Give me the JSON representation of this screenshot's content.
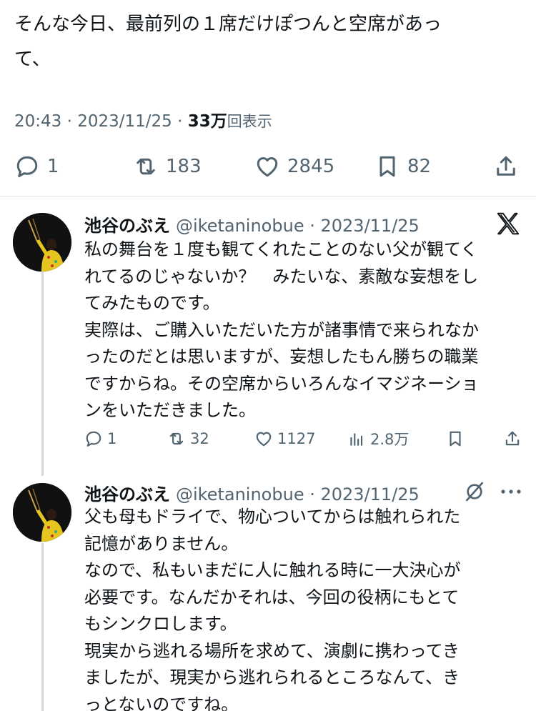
{
  "tweet": {
    "text_lines": [
      "そんな今日、最前列の１席だけぽつんと空席があっ",
      "て、"
    ],
    "time": "20:43",
    "sep": "·",
    "date": "2023/11/25",
    "views_count": "33万",
    "views_label": "回表示",
    "replies": "1",
    "retweets": "183",
    "likes": "2845",
    "bookmarks": "82"
  },
  "replies": [
    {
      "name": "池谷のぶえ",
      "handle": "@iketaninobue",
      "sep": "·",
      "date": "2023/11/25",
      "lines": [
        "私の舞台を１度も観てくれたことのない父が観てく",
        "れてるのじゃないか？　みたいな、素敵な妄想をし",
        "てみたものです。",
        "実際は、ご購入いただいた方が諸事情で来られなか",
        "ったのだとは思いますが、妄想したもん勝ちの職業",
        "ですからね。その空席からいろんなイマジネーショ",
        "ンをいただきました。"
      ],
      "stats": {
        "replies": "1",
        "retweets": "32",
        "likes": "1127",
        "views": "2.8万"
      }
    },
    {
      "name": "池谷のぶえ",
      "handle": "@iketaninobue",
      "sep": "·",
      "date": "2023/11/25",
      "lines": [
        "父も母もドライで、物心ついてからは触れられた",
        "記憶がありません。",
        "なので、私もいまだに人に触れる時に一大決心が",
        "必要です。なんだかそれは、今回の役柄にもとて",
        "もシンクロします。",
        "現実から逃れる場所を求めて、演劇に携わってき",
        "ましたが、現実から逃れられるところなんて、き",
        "っとないのですね。"
      ]
    }
  ]
}
